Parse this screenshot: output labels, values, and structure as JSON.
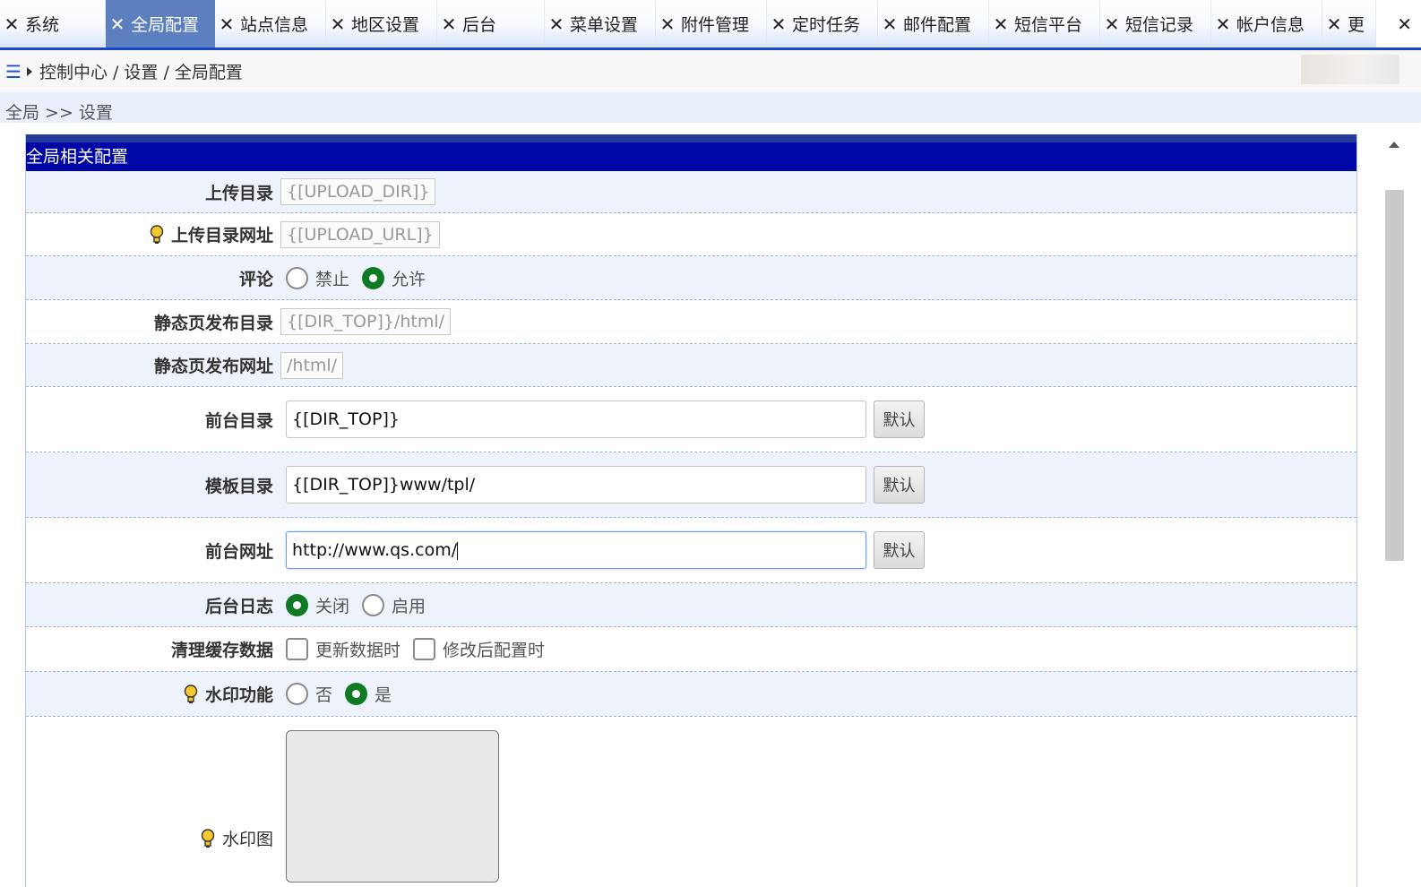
{
  "tabs": [
    {
      "label": "系统",
      "active": false
    },
    {
      "label": "全局配置",
      "active": true
    },
    {
      "label": "站点信息",
      "active": false
    },
    {
      "label": "地区设置",
      "active": false
    },
    {
      "label": "后台",
      "active": false
    },
    {
      "label": "菜单设置",
      "active": false
    },
    {
      "label": "附件管理",
      "active": false
    },
    {
      "label": "定时任务",
      "active": false
    },
    {
      "label": "邮件配置",
      "active": false
    },
    {
      "label": "短信平台",
      "active": false
    },
    {
      "label": "短信记录",
      "active": false
    },
    {
      "label": "帐户信息",
      "active": false
    },
    {
      "label": "更",
      "active": false
    }
  ],
  "breadcrumb": {
    "text": "控制中心 / 设置 / 全局配置",
    "menu_icon": "☰"
  },
  "path": "全局 >> 设置",
  "panel_title": "全局相关配置",
  "rows": {
    "upload_dir": {
      "label": "上传目录",
      "value": "{[UPLOAD_DIR]}"
    },
    "upload_url": {
      "label": "上传目录网址",
      "value": "{[UPLOAD_URL]}"
    },
    "comment": {
      "label": "评论",
      "opt1": "禁止",
      "opt2": "允许",
      "selected": "允许"
    },
    "static_dir": {
      "label": "静态页发布目录",
      "value": "{[DIR_TOP]}/html/"
    },
    "static_url": {
      "label": "静态页发布网址",
      "value": "/html/"
    },
    "front_dir": {
      "label": "前台目录",
      "value": "{[DIR_TOP]}",
      "button": "默认"
    },
    "tpl_dir": {
      "label": "模板目录",
      "value": "{[DIR_TOP]}www/tpl/",
      "button": "默认"
    },
    "front_url": {
      "label": "前台网址",
      "value": "http://www.qs.com/",
      "button": "默认"
    },
    "admin_log": {
      "label": "后台日志",
      "opt1": "关闭",
      "opt2": "启用",
      "selected": "关闭"
    },
    "cache_clear": {
      "label": "清理缓存数据",
      "opt1": "更新数据时",
      "opt2": "修改后配置时"
    },
    "watermark": {
      "label": "水印功能",
      "opt1": "否",
      "opt2": "是",
      "selected": "是"
    },
    "watermark_img": {
      "label": "水印图"
    }
  },
  "colors": {
    "accent": "#1b46c6",
    "panel_header": "#0007a7",
    "radio_on": "#0e7a24"
  }
}
